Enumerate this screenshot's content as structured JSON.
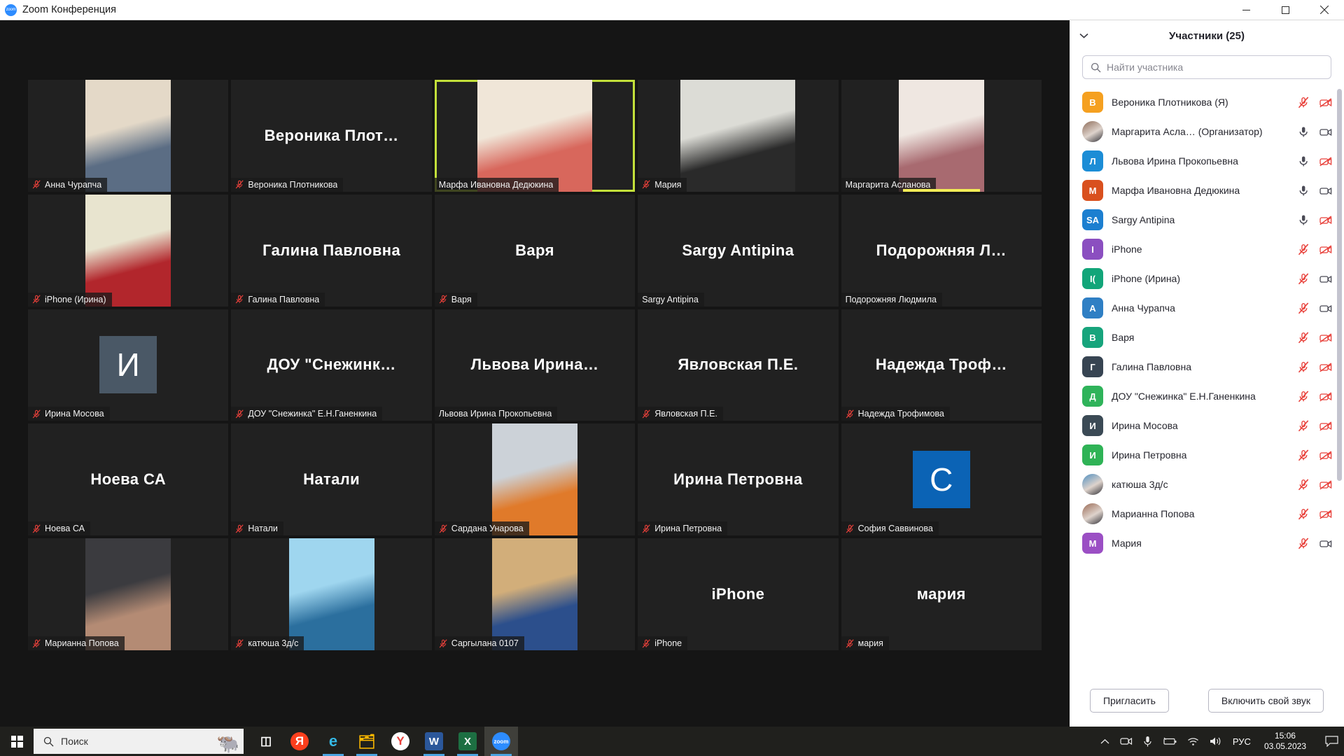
{
  "window": {
    "title": "Zoom Конференция",
    "logo_icon": "zoom-logo-icon",
    "minimize_label": "—",
    "maximize_label": "❐",
    "close_label": "✕"
  },
  "panel": {
    "title": "Участники (25)",
    "collapse_icon": "chevron-down-icon",
    "search": {
      "placeholder": "Найти участника",
      "value": "",
      "icon": "search-icon"
    },
    "participants": [
      {
        "name": "Вероника Плотникова (Я)",
        "initials": "В",
        "color": "#f5a020",
        "photo": false,
        "mic": "muted",
        "cam": "off"
      },
      {
        "name": "Маргарита Асла…  (Организатор)",
        "initials": "М",
        "color": "#8d6b58",
        "photo": true,
        "mic": "on",
        "cam": "on"
      },
      {
        "name": "Львова Ирина Прокопьевна",
        "initials": "Л",
        "color": "#1c8dd6",
        "photo": false,
        "mic": "on",
        "cam": "off"
      },
      {
        "name": "Марфа Ивановна Дедюкина",
        "initials": "М",
        "color": "#d9501e",
        "photo": false,
        "mic": "on",
        "cam": "on"
      },
      {
        "name": "Sargy Antipina",
        "initials": "SA",
        "color": "#1c7fd0",
        "photo": false,
        "mic": "on",
        "cam": "off"
      },
      {
        "name": "iPhone",
        "initials": "I",
        "color": "#8b4fc0",
        "photo": false,
        "mic": "muted",
        "cam": "off"
      },
      {
        "name": "iPhone (Ирина)",
        "initials": "I(",
        "color": "#12a579",
        "photo": false,
        "mic": "muted",
        "cam": "on"
      },
      {
        "name": "Анна Чурапча",
        "initials": "А",
        "color": "#2f7fc4",
        "photo": false,
        "mic": "muted",
        "cam": "on"
      },
      {
        "name": "Варя",
        "initials": "В",
        "color": "#17a47c",
        "photo": false,
        "mic": "muted",
        "cam": "off"
      },
      {
        "name": "Галина Павловна",
        "initials": "Г",
        "color": "#374452",
        "photo": false,
        "mic": "muted",
        "cam": "off"
      },
      {
        "name": "ДОУ \"Снежинка\" Е.Н.Ганенкина",
        "initials": "Д",
        "color": "#2fb35a",
        "photo": false,
        "mic": "muted",
        "cam": "off"
      },
      {
        "name": "Ирина Мосова",
        "initials": "И",
        "color": "#3b4a55",
        "photo": false,
        "mic": "muted",
        "cam": "off"
      },
      {
        "name": "Ирина Петровна",
        "initials": "И",
        "color": "#2fb356",
        "photo": false,
        "mic": "muted",
        "cam": "off"
      },
      {
        "name": "катюша 3д/с",
        "initials": "к",
        "color": "#4f8fc0",
        "photo": true,
        "mic": "muted",
        "cam": "off"
      },
      {
        "name": "Марианна Попова",
        "initials": "М",
        "color": "#9a6a55",
        "photo": true,
        "mic": "muted",
        "cam": "off"
      },
      {
        "name": "Мария",
        "initials": "М",
        "color": "#9b4fc4",
        "photo": false,
        "mic": "muted",
        "cam": "on"
      }
    ],
    "footer": {
      "invite_label": "Пригласить",
      "unmute_label": "Включить свой звук"
    }
  },
  "stage": {
    "active_border_color": "#c3e03a",
    "tiles": [
      {
        "label": "Анна Чурапча",
        "display": "video",
        "muted": true,
        "active": false,
        "bottom_highlight": false,
        "bigname": "",
        "media": "photo-room-woman",
        "tint1": "#e4d9c8",
        "tint2": "#5b6d84"
      },
      {
        "label": "Вероника Плотникова",
        "display": "name",
        "muted": true,
        "active": false,
        "bottom_highlight": false,
        "bigname": "Вероника  Плот…"
      },
      {
        "label": "Марфа Ивановна Дедюкина",
        "display": "video",
        "muted": false,
        "active": true,
        "bottom_highlight": false,
        "bigname": "",
        "media": "photo-woman-pink",
        "tint1": "#f0e6d8",
        "tint2": "#d8675c"
      },
      {
        "label": "Мария",
        "display": "video",
        "muted": true,
        "active": false,
        "bottom_highlight": false,
        "bigname": "",
        "media": "photo-woman-window",
        "tint1": "#dcdcd6",
        "tint2": "#2a2a2a"
      },
      {
        "label": "Маргарита Асланова",
        "display": "video",
        "muted": false,
        "active": false,
        "bottom_highlight": true,
        "bigname": "",
        "media": "photo-woman-shelf",
        "tint1": "#efe7e1",
        "tint2": "#a86a70"
      },
      {
        "label": "iPhone (Ирина)",
        "display": "video",
        "muted": true,
        "active": false,
        "bottom_highlight": false,
        "bigname": "",
        "media": "photo-woman-red",
        "tint1": "#e8e4cf",
        "tint2": "#b2262c"
      },
      {
        "label": "Галина Павловна",
        "display": "name",
        "muted": true,
        "active": false,
        "bottom_highlight": false,
        "bigname": "Галина Павловна"
      },
      {
        "label": "Варя",
        "display": "name",
        "muted": true,
        "active": false,
        "bottom_highlight": false,
        "bigname": "Варя"
      },
      {
        "label": "Sargy Antipina",
        "display": "name",
        "muted": false,
        "active": false,
        "bottom_highlight": false,
        "bigname": "Sargy Antipina"
      },
      {
        "label": "Подорожняя Людмила",
        "display": "name",
        "muted": false,
        "active": false,
        "bottom_highlight": false,
        "bigname": "Подорожняя Л…"
      },
      {
        "label": "Ирина Мосова",
        "display": "avatar",
        "muted": true,
        "active": false,
        "bottom_highlight": false,
        "bigname": "",
        "avatar_letter": "И",
        "avatar_color": "#4a5866"
      },
      {
        "label": "ДОУ \"Снежинка\" Е.Н.Ганенкина",
        "display": "name",
        "muted": true,
        "active": false,
        "bottom_highlight": false,
        "bigname": "ДОУ  \"Снежинк…"
      },
      {
        "label": "Львова Ирина Прокопьевна",
        "display": "name",
        "muted": false,
        "active": false,
        "bottom_highlight": false,
        "bigname": "Львова  Ирина…"
      },
      {
        "label": "Явловская П.Е.",
        "display": "name",
        "muted": true,
        "active": false,
        "bottom_highlight": false,
        "bigname": "Явловская П.Е."
      },
      {
        "label": "Надежда Трофимова",
        "display": "name",
        "muted": true,
        "active": false,
        "bottom_highlight": false,
        "bigname": "Надежда  Троф…"
      },
      {
        "label": "Ноева СА",
        "display": "name",
        "muted": true,
        "active": false,
        "bottom_highlight": false,
        "bigname": "Ноева СА"
      },
      {
        "label": "Натали",
        "display": "name",
        "muted": true,
        "active": false,
        "bottom_highlight": false,
        "bigname": "Натали"
      },
      {
        "label": "Сардана Унарова",
        "display": "video",
        "muted": true,
        "active": false,
        "bottom_highlight": false,
        "bigname": "",
        "media": "photo-woman-mask",
        "tint1": "#ccd2d8",
        "tint2": "#e07a2a"
      },
      {
        "label": "Ирина Петровна",
        "display": "name",
        "muted": true,
        "active": false,
        "bottom_highlight": false,
        "bigname": "Ирина Петровна"
      },
      {
        "label": "София Саввинова",
        "display": "avatar",
        "muted": true,
        "active": false,
        "bottom_highlight": false,
        "bigname": "",
        "avatar_letter": "С",
        "avatar_color": "#0b63b5"
      },
      {
        "label": "Марианна Попова",
        "display": "video",
        "muted": true,
        "active": false,
        "bottom_highlight": false,
        "bigname": "",
        "media": "photo-woman-dark",
        "tint1": "#3b3b3f",
        "tint2": "#b48b74"
      },
      {
        "label": "катюша 3д/с",
        "display": "video",
        "muted": true,
        "active": false,
        "bottom_highlight": false,
        "bigname": "",
        "media": "photo-woman-blue",
        "tint1": "#9fd6ef",
        "tint2": "#2b6f9e"
      },
      {
        "label": "Саргылана 0107",
        "display": "video",
        "muted": true,
        "active": false,
        "bottom_highlight": false,
        "bigname": "",
        "media": "photo-room-shelves",
        "tint1": "#d2ae7a",
        "tint2": "#2c4f8c"
      },
      {
        "label": "iPhone",
        "display": "name",
        "muted": true,
        "active": false,
        "bottom_highlight": false,
        "bigname": "iPhone"
      },
      {
        "label": "мария",
        "display": "name",
        "muted": true,
        "active": false,
        "bottom_highlight": false,
        "bigname": "мария"
      }
    ]
  },
  "taskbar": {
    "start_icon": "windows-start-icon",
    "search_placeholder": "Поиск",
    "search_value": "",
    "search_icon": "search-icon",
    "wallpaper_icon": "gnu-wildebeest-icon",
    "items": [
      {
        "name": "task-view-icon",
        "glyph": "◫"
      },
      {
        "name": "yandex-browser-icon",
        "glyph": "Я"
      },
      {
        "name": "microsoft-edge-icon",
        "glyph": "e"
      },
      {
        "name": "file-explorer-icon",
        "glyph": "🗂"
      },
      {
        "name": "yandex-icon",
        "glyph": "Y"
      },
      {
        "name": "microsoft-word-icon",
        "glyph": "W"
      },
      {
        "name": "microsoft-excel-icon",
        "glyph": "X"
      },
      {
        "name": "zoom-icon",
        "glyph": "zoom"
      }
    ],
    "tray": {
      "chevron_icon": "chevron-up-icon",
      "camera_icon": "camera-icon",
      "mic_icon": "microphone-icon",
      "battery_icon": "battery-icon",
      "wifi_icon": "wifi-icon",
      "volume_icon": "volume-icon",
      "language": "РУС",
      "time": "15:06",
      "date": "03.05.2023",
      "notification_icon": "notification-icon"
    }
  }
}
